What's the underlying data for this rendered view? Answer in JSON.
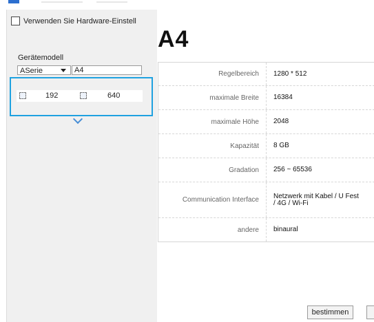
{
  "settings": {
    "use_hardware_label": "Verwenden Sie Hardware-Einstell"
  },
  "model": {
    "label": "Gerätemodell",
    "series_selected": "ASerie",
    "model_value": "A4"
  },
  "dimensions": {
    "width": "192",
    "height": "640"
  },
  "product": {
    "title": "A4"
  },
  "specs": [
    {
      "label": "Regelbereich",
      "value": "1280 * 512"
    },
    {
      "label": "maximale Breite",
      "value": "16384"
    },
    {
      "label": "maximale Höhe",
      "value": "2048"
    },
    {
      "label": "Kapazität",
      "value": "8 GB"
    },
    {
      "label": "Gradation",
      "value": "256 ~ 65536"
    },
    {
      "label": "Communication Interface",
      "value": "Netzwerk mit Kabel / U Fest\n/ 4G / Wi-Fi"
    },
    {
      "label": "andere",
      "value": "binaural"
    }
  ],
  "footer": {
    "confirm_label": "bestimmen"
  }
}
